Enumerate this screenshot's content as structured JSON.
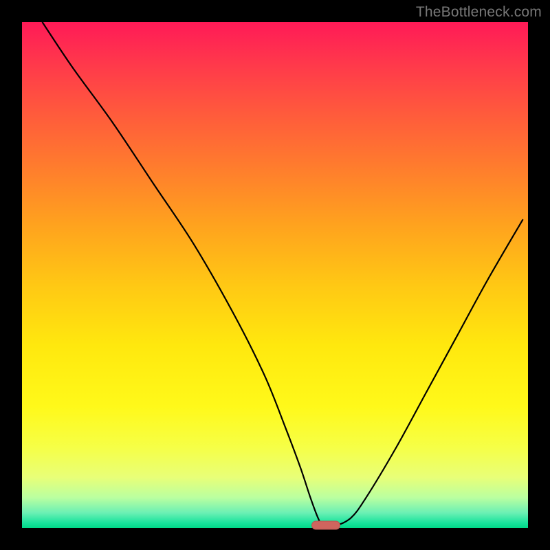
{
  "watermark": "TheBottleneck.com",
  "chart_data": {
    "type": "line",
    "title": "",
    "xlabel": "",
    "ylabel": "",
    "xlim": [
      0,
      100
    ],
    "ylim": [
      0,
      100
    ],
    "grid": false,
    "legend": false,
    "background_gradient": {
      "direction": "vertical",
      "stops": [
        {
          "pos": 0,
          "color": "#ff1a57"
        },
        {
          "pos": 40,
          "color": "#ffa21e"
        },
        {
          "pos": 76,
          "color": "#fff91a"
        },
        {
          "pos": 100,
          "color": "#00d988"
        }
      ]
    },
    "series": [
      {
        "name": "bottleneck-curve",
        "x": [
          4,
          10,
          18,
          26,
          34,
          42,
          48,
          52,
          55,
          57,
          58.5,
          59.5,
          62,
          65,
          68,
          74,
          80,
          86,
          92,
          99
        ],
        "y": [
          100,
          91,
          80,
          68,
          56,
          42,
          30,
          20,
          12,
          6,
          2,
          0.5,
          0.5,
          2,
          6,
          16,
          27,
          38,
          49,
          61
        ]
      }
    ],
    "marker": {
      "name": "optimal-point",
      "x": 60,
      "y": 0.5,
      "color": "#cf655e",
      "shape": "pill"
    }
  }
}
